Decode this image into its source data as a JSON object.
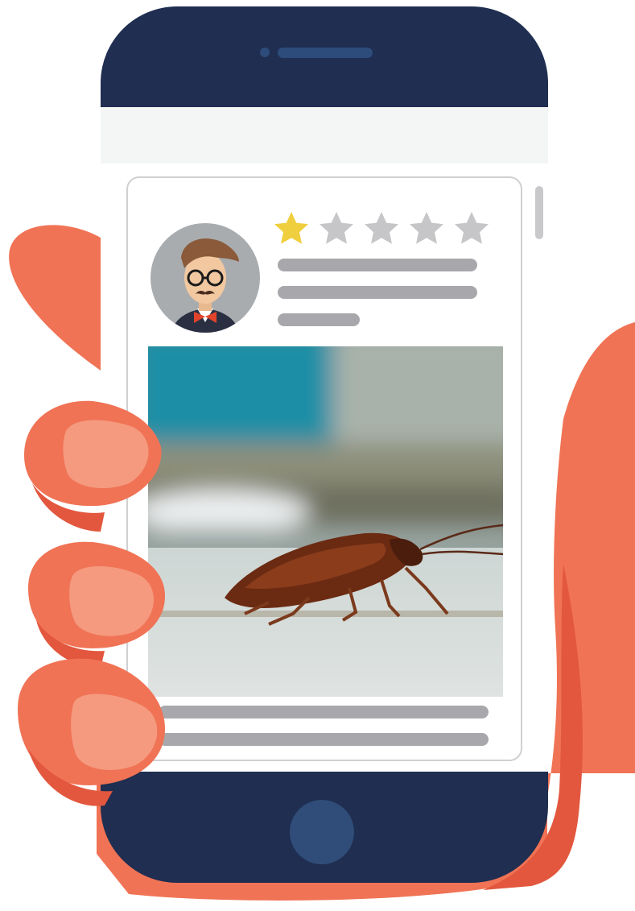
{
  "colors": {
    "phone_body": "#1f2e51",
    "speaker": "#2d4b7b",
    "home_button": "#2f4d78",
    "screen_bg": "#f4f5f5",
    "card_border": "#d0d0d2",
    "skeleton_line": "#a8a8ac",
    "star_filled": "#f0cf3f",
    "star_empty": "#c6c6c8",
    "avatar_bg": "#a9acaf",
    "hand": "#f07355",
    "hand_shadow": "#e2573e",
    "fingernail": "#f59a7f",
    "scrollbar": "#c9c9cb"
  },
  "review": {
    "rating": 1,
    "max_rating": 5,
    "stars": [
      {
        "icon": "star-filled-icon"
      },
      {
        "icon": "star-empty-icon"
      },
      {
        "icon": "star-empty-icon"
      },
      {
        "icon": "star-empty-icon"
      },
      {
        "icon": "star-empty-icon"
      }
    ],
    "avatar_icon": "reviewer-avatar-icon",
    "photo_icon": "cockroach-photo-icon"
  }
}
